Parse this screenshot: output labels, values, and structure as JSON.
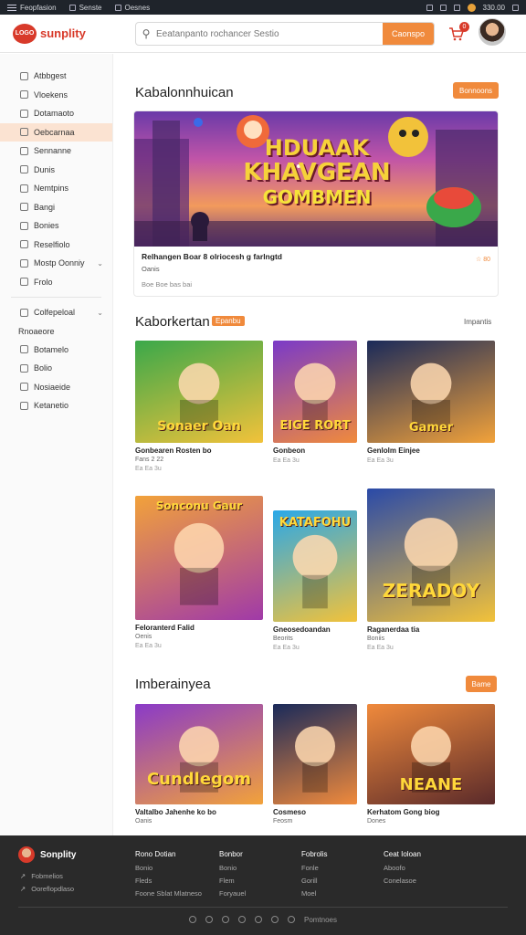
{
  "sysbar": {
    "items": [
      "Feopfasion",
      "Senste",
      "Oesnes"
    ],
    "right_value": "330.00"
  },
  "header": {
    "logo_badge": "LOGO",
    "logo_text": "sunplity",
    "search_placeholder": "Eeatanpanto rochancer Sestio",
    "search_button": "Caonspo",
    "cart_count": "0"
  },
  "sidebar": {
    "items": [
      {
        "label": "Atbbgest",
        "active": false
      },
      {
        "label": "Vloekens",
        "active": false
      },
      {
        "label": "Dotamaoto",
        "active": false
      },
      {
        "label": "Oebcarnaa",
        "active": true
      },
      {
        "label": "Sennanne",
        "active": false
      },
      {
        "label": "Dunis",
        "active": false
      },
      {
        "label": "Nemtpins",
        "active": false
      },
      {
        "label": "Bangi",
        "active": false
      },
      {
        "label": "Bonies",
        "active": false
      },
      {
        "label": "Reselfiolo",
        "active": false
      },
      {
        "label": "Mostp Oonniy",
        "active": false
      },
      {
        "label": "Frolo",
        "active": false
      }
    ],
    "group_item": "Colfepeloal",
    "section_title": "Rnoaeore",
    "sub_items": [
      "Botamelo",
      "Bolio",
      "Nosiaeide",
      "Ketanetio"
    ]
  },
  "main": {
    "section1": {
      "title": "Kabalonnhuican",
      "button": "Bonnoons",
      "banner_line1": "HDUAAK",
      "banner_line2": "KHAVGEAN",
      "banner_line3": "GOMBMEN",
      "caption_title": "Relhangen Boar 8 olriocesh g farlngtd",
      "caption_sub": "Oanis",
      "caption_meta": "Boe Boe bas bai",
      "caption_tag": "☆ 80"
    },
    "section2": {
      "title": "Kaborkertan",
      "badge": "Epanbu",
      "see_all": "Impantis",
      "cards": [
        {
          "thumb_text": "Sonaer Oan",
          "title": "Gonbearen Rosten bo",
          "sub": "Fans 2 22",
          "meta": "Ea Ea 3u",
          "c1": "#3aa84a",
          "c2": "#f2c23a"
        },
        {
          "thumb_text": "EIGE RORT",
          "title": "Gonbeon",
          "sub": "",
          "meta": "Ea Ea 3u",
          "c1": "#7a3ac8",
          "c2": "#f08a3c"
        },
        {
          "thumb_text": "Gamer",
          "title": "Genlolm Einjee",
          "sub": "",
          "meta": "Ea Ea 3u",
          "c1": "#1a2a5a",
          "c2": "#f2a23a"
        },
        {
          "thumb_text": "Sonconu Gaur",
          "title": "Feloranterd Falid",
          "sub": "Oenis",
          "meta": "Ea Ea 3u",
          "c1": "#f2a23a",
          "c2": "#a03aa8"
        },
        {
          "thumb_text": "KATAFOHU",
          "title": "Gneosedoandan",
          "sub": "Beorits",
          "meta": "Ea Ea 3u",
          "c1": "#2aa8e8",
          "c2": "#f2c23a"
        },
        {
          "thumb_text": "ZERADOY",
          "title": "Raganerdaa tia",
          "sub": "Boniis",
          "meta": "Ea Ea 3u",
          "c1": "#2a4aa8",
          "c2": "#f2c23a"
        }
      ]
    },
    "section3": {
      "title": "Imberainyea",
      "button": "Bame",
      "cards": [
        {
          "thumb_text": "Cundlegom",
          "title": "Valtalbo Jahenhe ko bo",
          "sub": "Oanis",
          "meta": "",
          "c1": "#8a3ac8",
          "c2": "#f2a23a"
        },
        {
          "thumb_text": "",
          "title": "Cosmeso",
          "sub": "Feosm",
          "meta": "",
          "c1": "#1a2a5a",
          "c2": "#f08a3c"
        },
        {
          "thumb_text": "NEANE",
          "title": "Kerhatom Gong biog",
          "sub": "Dones",
          "meta": "",
          "c1": "#f08a3c",
          "c2": "#5a2a2a"
        }
      ]
    }
  },
  "footer": {
    "logo_text": "Sonplity",
    "left_links": [
      "Fobmelios",
      "Ooreflopdlaso"
    ],
    "columns": [
      {
        "heading": "Rono Dotian",
        "links": [
          "Bonio",
          "Fleds",
          "Foone Sblat Mlatneso"
        ]
      },
      {
        "heading": "Bonbor",
        "links": [
          "Bonio",
          "Flem",
          "Foryauel"
        ]
      },
      {
        "heading": "Fobrolis",
        "links": [
          "Fonle",
          "Gorill",
          "Moel"
        ]
      },
      {
        "heading": "Ceat Ioloan",
        "links": [
          "Aboofo",
          "Conelasoe"
        ]
      }
    ],
    "social_label": "Pomtnoes"
  },
  "colors": {
    "accent": "#f08a3c",
    "brand_red": "#d83a2a",
    "sidebar_active": "#fbe3d2",
    "footer_bg": "#2a2a2a"
  }
}
